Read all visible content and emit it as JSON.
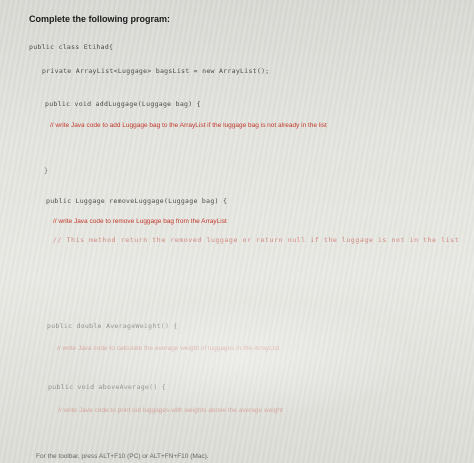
{
  "heading": "Complete the following program:",
  "lines": {
    "class_decl": "public class Etihad{",
    "field_decl": "private ArrayList<Luggage> bagsList = new ArrayList();",
    "add_method": "public void addLuggage(Luggage bag) {",
    "add_comment": "// write Java code to add Luggage bag to the ArrayList if the luggage bag is not already in the list",
    "remove_method": "public Luggage removeLuggage(Luggage bag) {",
    "remove_comment": "// write Java code to remove Luggage bag from the ArrayList",
    "remove_comment2": "// This method return the removed luggage or return null if the luggage is not in the list",
    "avg_method": "public double AverageWeight() {",
    "avg_comment": "// write Java code to calculate the average weight of luggages in the ArrayList",
    "above_method": "public void aboveAverage() {",
    "above_comment": "// write Java code to print out luggages with weights above the average weight",
    "close_brace": "}"
  },
  "footer": "For the toolbar, press ALT+F10 (PC) or ALT+FN+F10 (Mac)."
}
